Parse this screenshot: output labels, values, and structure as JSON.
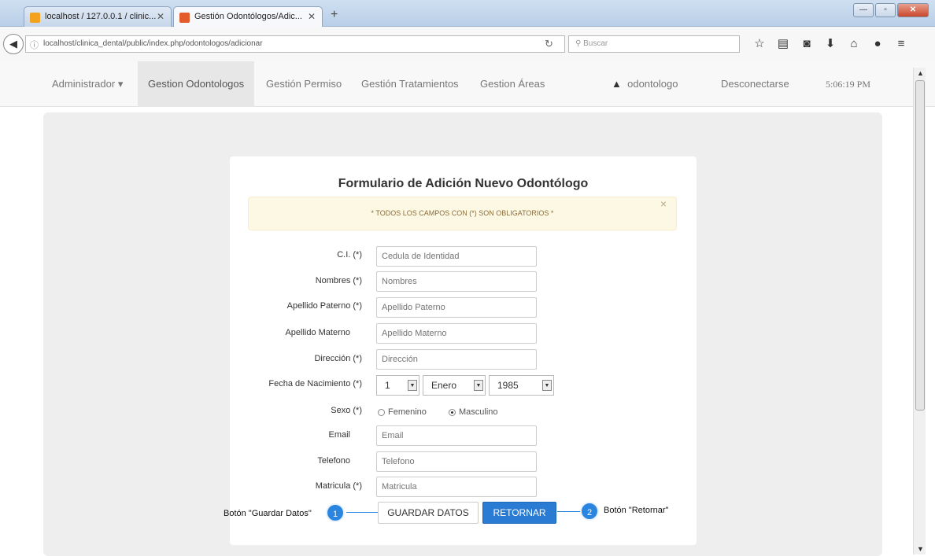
{
  "browser": {
    "tabs": [
      {
        "label": "localhost / 127.0.0.1 / clinic..."
      },
      {
        "label": "Gestión Odontólogos/Adic..."
      }
    ],
    "url": "localhost/clinica_dental/public/index.php/odontologos/adicionar",
    "search_placeholder": "Buscar",
    "toolbar_icons": [
      "star-icon",
      "reading-list-icon",
      "pocket-icon",
      "download-icon",
      "home-icon",
      "chat-icon",
      "menu-icon"
    ]
  },
  "nav": {
    "admin": "Administrador",
    "items": [
      "Gestion Odontologos",
      "Gestión Permiso",
      "Gestión Tratamientos",
      "Gestion Áreas"
    ],
    "user": "odontologo",
    "logout": "Desconectarse",
    "time": "5:06:19 PM"
  },
  "form": {
    "title": "Formulario de Adición Nuevo Odontólogo",
    "alert": "* TODOS LOS CAMPOS CON (*) SON OBLIGATORIOS *",
    "fields": [
      {
        "label": "C.I. (*)",
        "placeholder": "Cedula de Identidad"
      },
      {
        "label": "Nombres (*)",
        "placeholder": "Nombres"
      },
      {
        "label": "Apellido Paterno (*)",
        "placeholder": "Apellido Paterno"
      },
      {
        "label": "Apellido Materno",
        "placeholder": "Apellido Materno"
      },
      {
        "label": "Dirección (*)",
        "placeholder": "Dirección"
      },
      {
        "label": "Email",
        "placeholder": "Email"
      },
      {
        "label": "Telefono",
        "placeholder": "Telefono"
      },
      {
        "label": "Matricula (*)",
        "placeholder": "Matricula"
      }
    ],
    "birth": {
      "label": "Fecha de Nacimiento (*)",
      "day": "1",
      "month": "Enero",
      "year": "1985"
    },
    "sex": {
      "label": "Sexo (*)",
      "female": "Femenino",
      "male": "Masculino",
      "selected": "Masculino"
    },
    "save_button": "GUARDAR DATOS",
    "back_button": "RETORNAR"
  },
  "callouts": [
    {
      "number": "1",
      "text": "Botón \"Guardar Datos\""
    },
    {
      "number": "2",
      "text": "Botón \"Retornar\""
    }
  ]
}
